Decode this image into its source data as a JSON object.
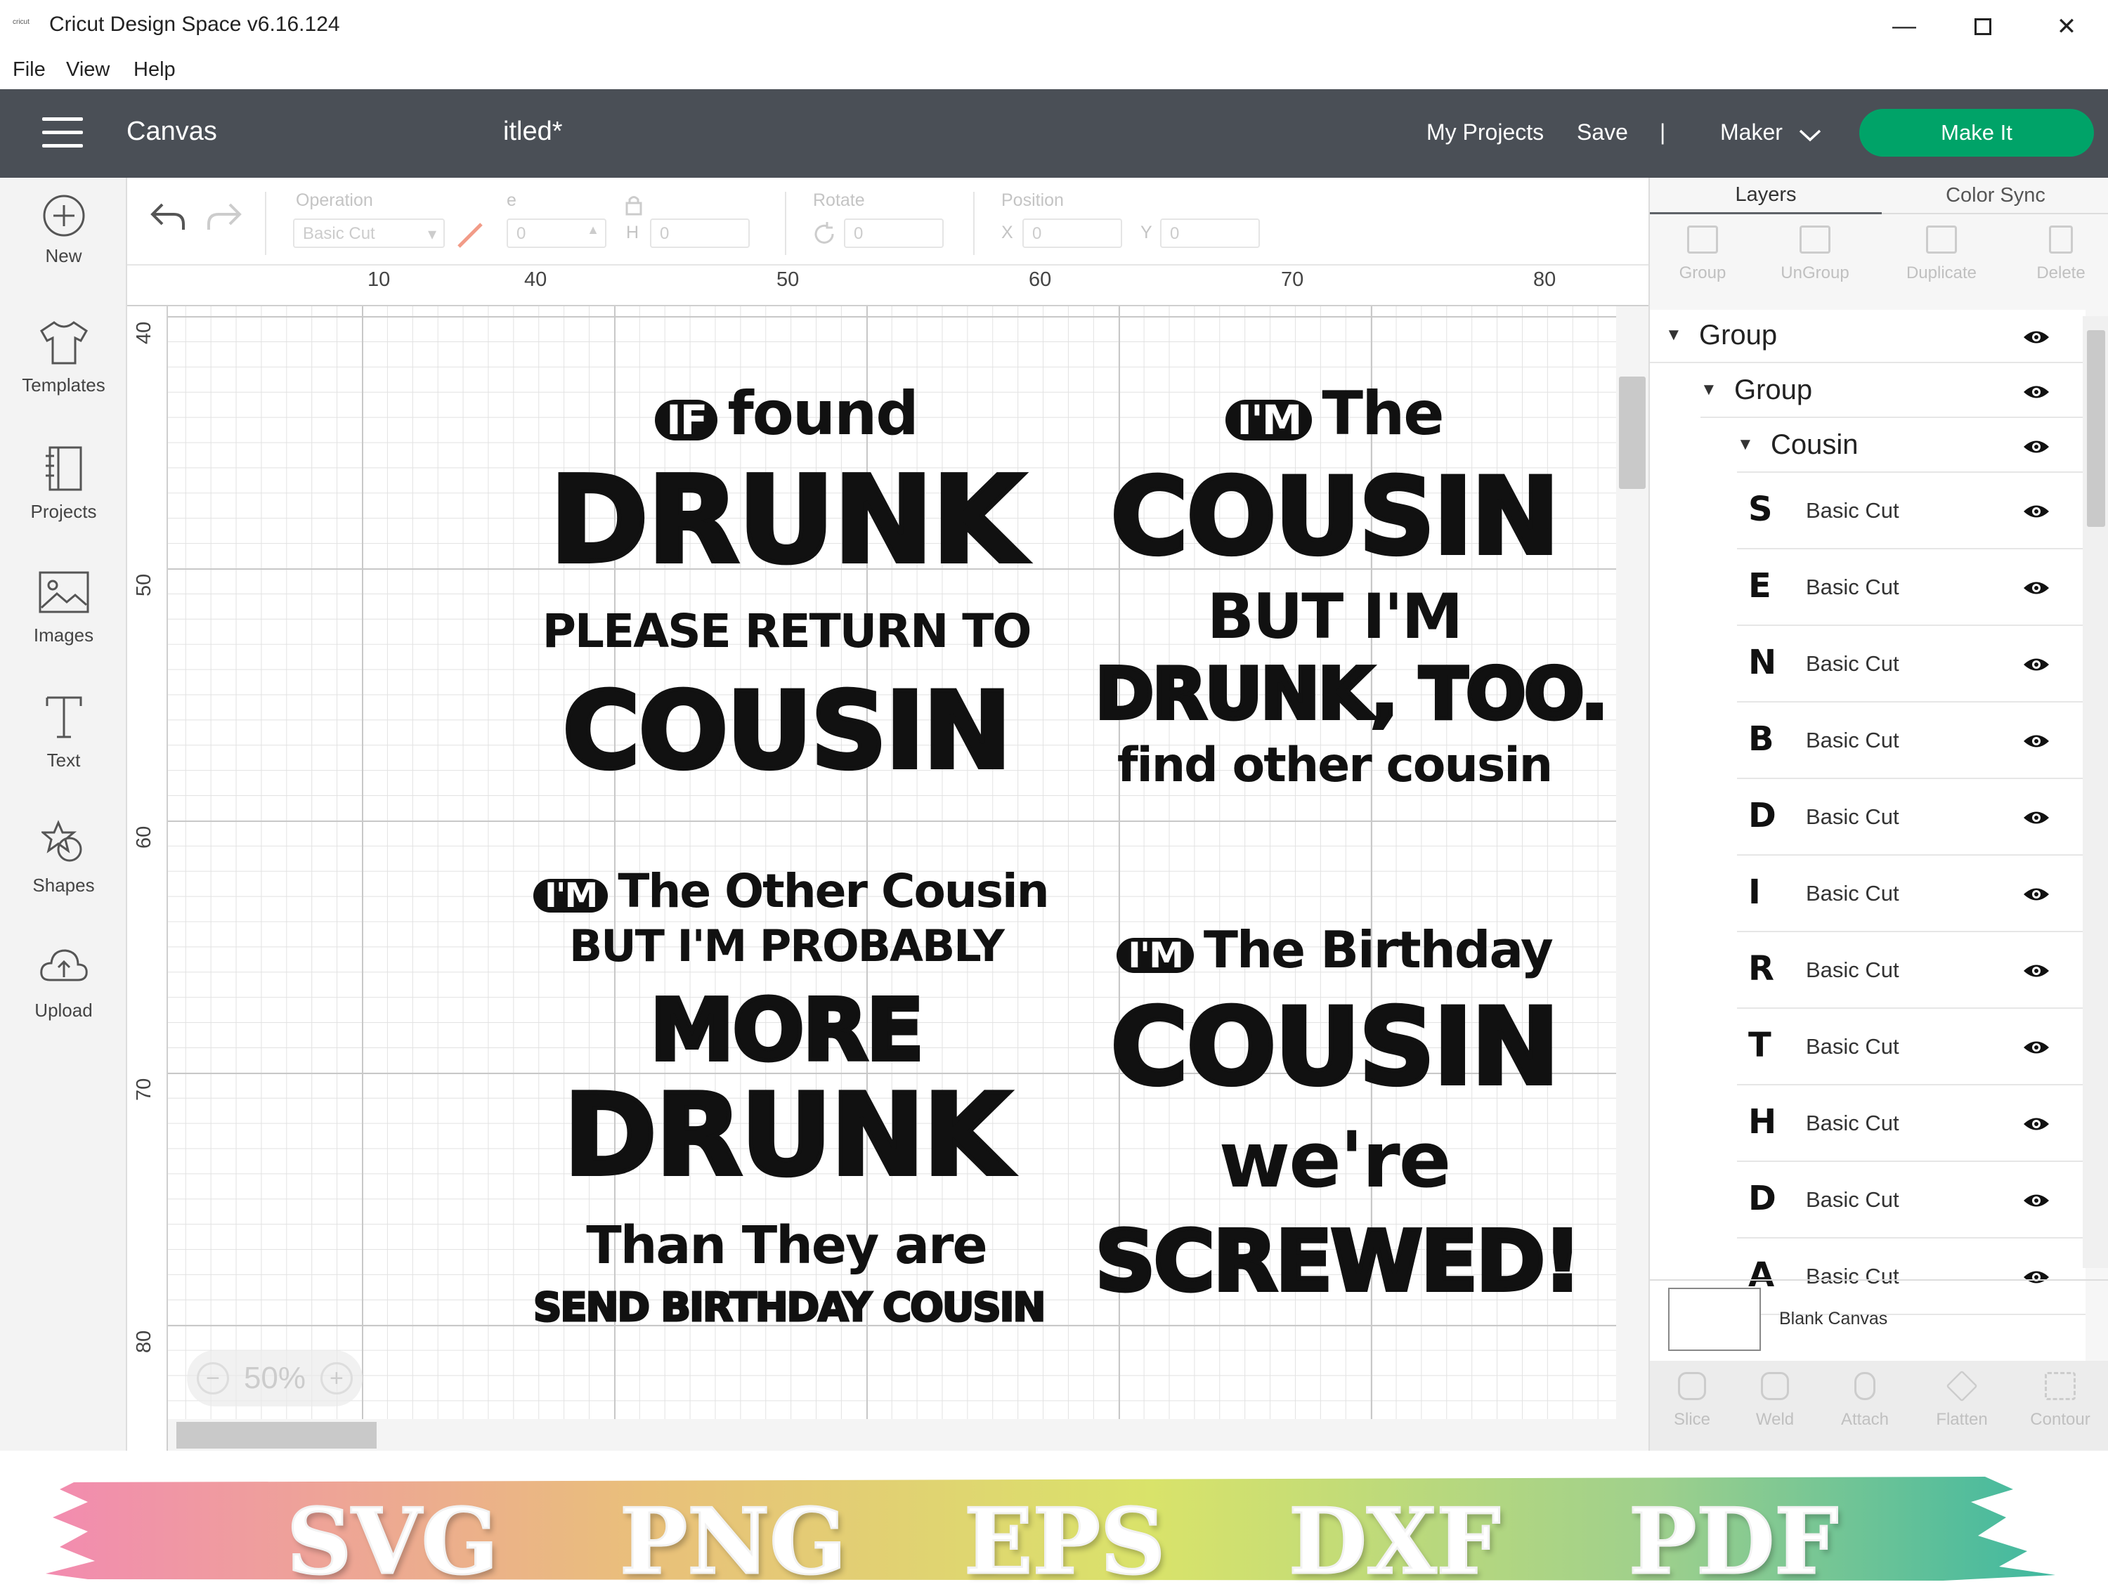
{
  "window": {
    "title": "Cricut Design Space  v6.16.124",
    "logo": "cricut"
  },
  "menu": [
    "File",
    "View",
    "Help"
  ],
  "header": {
    "section": "Canvas",
    "project": "itled*",
    "my_projects": "My Projects",
    "save": "Save",
    "separator": "|",
    "machine": "Maker",
    "make_it": "Make It"
  },
  "sidebar": [
    {
      "label": "New",
      "icon": "plus-circle-icon"
    },
    {
      "label": "Templates",
      "icon": "tshirt-icon"
    },
    {
      "label": "Projects",
      "icon": "notebook-icon"
    },
    {
      "label": "Images",
      "icon": "image-icon"
    },
    {
      "label": "Text",
      "icon": "text-t-icon"
    },
    {
      "label": "Shapes",
      "icon": "shapes-icon"
    },
    {
      "label": "Upload",
      "icon": "cloud-upload-icon"
    }
  ],
  "toolbar": {
    "operation_label": "Operation",
    "operation_value": "Basic Cut",
    "size_label": "e",
    "w_value": "0",
    "h_label": "H",
    "h_value": "0",
    "rotate_label": "Rotate",
    "rotate_value": "0",
    "position_label": "Position",
    "x_label": "X",
    "x_value": "0",
    "y_label": "Y",
    "y_value": "0"
  },
  "ruler": {
    "top": [
      "10",
      "40",
      "50",
      "60",
      "70",
      "80"
    ],
    "left": [
      "40",
      "50",
      "60",
      "70",
      "80"
    ]
  },
  "zoom": "50%",
  "designs": {
    "d1": {
      "badge": "IF",
      "l1": "found",
      "l2": "DRUNK",
      "l3": "PLEASE RETURN TO",
      "l4": "COUSIN"
    },
    "d2": {
      "badge": "I'M",
      "l1": "The",
      "l2": "COUSIN",
      "l3": "BUT I'M",
      "l4": "DRUNK, TOO.",
      "l5": "find other cousin"
    },
    "d3": {
      "badge": "I'M",
      "l1": "The Other Cousin",
      "l2": "BUT I'M PROBABLY",
      "l3": "MORE",
      "l4": "DRUNK",
      "l5": "Than They are",
      "l6": "SEND BIRTHDAY COUSIN"
    },
    "d4": {
      "badge": "I'M",
      "l1": "The Birthday",
      "l2": "COUSIN",
      "l3": "we're",
      "l4": "SCREWED!"
    }
  },
  "panel": {
    "tabs": [
      "Layers",
      "Color Sync"
    ],
    "tools": [
      "Group",
      "UnGroup",
      "Duplicate",
      "Delete"
    ],
    "tree": [
      "Group",
      "Group",
      "Cousin"
    ],
    "layers": [
      {
        "letter": "S",
        "op": "Basic Cut"
      },
      {
        "letter": "E",
        "op": "Basic Cut"
      },
      {
        "letter": "N",
        "op": "Basic Cut"
      },
      {
        "letter": "B",
        "op": "Basic Cut"
      },
      {
        "letter": "D",
        "op": "Basic Cut"
      },
      {
        "letter": "I",
        "op": "Basic Cut"
      },
      {
        "letter": "R",
        "op": "Basic Cut"
      },
      {
        "letter": "T",
        "op": "Basic Cut"
      },
      {
        "letter": "H",
        "op": "Basic Cut"
      },
      {
        "letter": "D",
        "op": "Basic Cut"
      },
      {
        "letter": "A",
        "op": "Basic Cut"
      }
    ],
    "blank_canvas": "Blank Canvas",
    "bottom_tools": [
      "Slice",
      "Weld",
      "Attach",
      "Flatten",
      "Contour"
    ]
  },
  "banner": {
    "formats": [
      "SVG",
      "PNG",
      "EPS",
      "DXF",
      "PDF"
    ],
    "colors": [
      "#f28bb0",
      "#e9c07a",
      "#d9e36a",
      "#9fd08c",
      "#3fb8a0"
    ]
  }
}
